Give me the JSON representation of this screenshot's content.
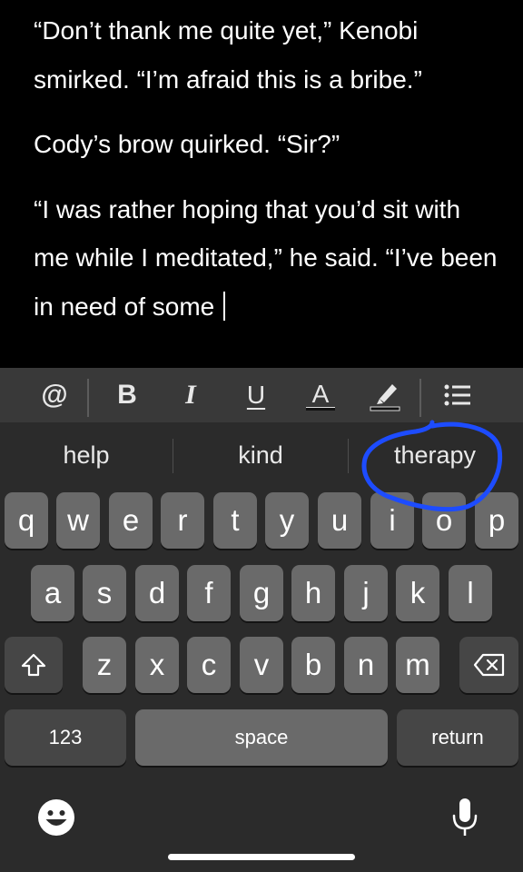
{
  "editor": {
    "paragraphs": [
      "“Don’t thank me quite yet,” Kenobi smirked. “I’m afraid this is a bribe.”",
      "Cody’s brow quirked. “Sir?”",
      "“I was rather hoping that you’d sit with me while I meditated,” he said. “I’ve been in need of some"
    ]
  },
  "toolbar": {
    "items": [
      {
        "label": "@",
        "icon": "at-icon"
      },
      {
        "label": "B",
        "icon": "bold-icon"
      },
      {
        "label": "I",
        "icon": "italic-icon"
      },
      {
        "label": "U",
        "icon": "underline-icon"
      },
      {
        "label": "A",
        "icon": "text-color-icon"
      },
      {
        "icon": "highlighter-icon"
      },
      {
        "icon": "list-icon"
      }
    ]
  },
  "suggestions": [
    "help",
    "kind",
    "therapy"
  ],
  "annotation_color": "#1d4cff",
  "keyboard": {
    "row1": [
      "q",
      "w",
      "e",
      "r",
      "t",
      "y",
      "u",
      "i",
      "o",
      "p"
    ],
    "row2": [
      "a",
      "s",
      "d",
      "f",
      "g",
      "h",
      "j",
      "k",
      "l"
    ],
    "row3": [
      "z",
      "x",
      "c",
      "v",
      "b",
      "n",
      "m"
    ],
    "numbers_label": "123",
    "space_label": "space",
    "return_label": "return"
  }
}
